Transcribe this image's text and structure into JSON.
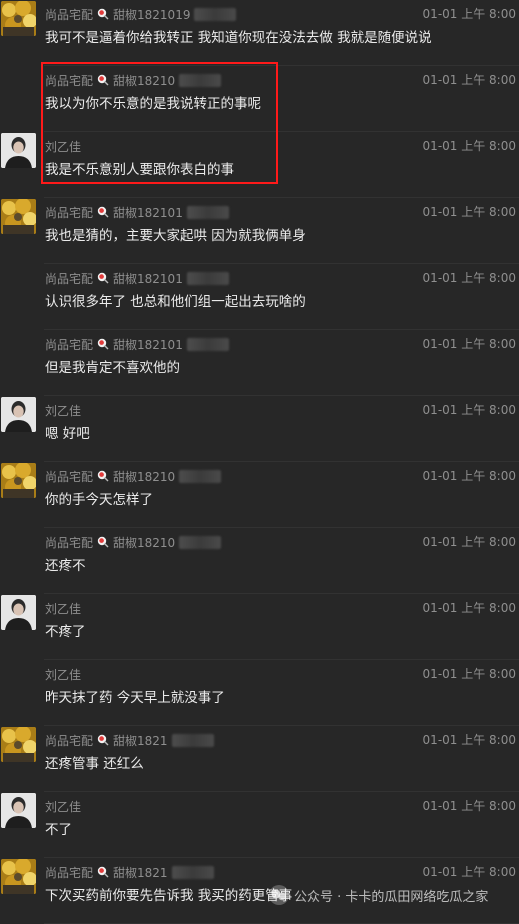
{
  "messages": [
    {
      "sender": "尚品宅配",
      "tag": "甜椒1821019",
      "time": "01-01 上午 8:00",
      "text": "我可不是逼着你给我转正 我知道你现在没法去做 我就是随便说说",
      "avatar": "yellow"
    },
    {
      "sender": "尚品宅配",
      "tag": "甜椒18210",
      "time": "01-01 上午 8:00",
      "text": "我以为你不乐意的是我说转正的事呢",
      "avatar": ""
    },
    {
      "sender": "刘乙佳",
      "tag": "",
      "time": "01-01 上午 8:00",
      "text": "我是不乐意别人要跟你表白的事",
      "avatar": "gray"
    },
    {
      "sender": "尚品宅配",
      "tag": "甜椒182101",
      "time": "01-01 上午 8:00",
      "text": "我也是猜的，主要大家起哄 因为就我俩单身",
      "avatar": "yellow"
    },
    {
      "sender": "尚品宅配",
      "tag": "甜椒182101",
      "time": "01-01 上午 8:00",
      "text": "认识很多年了 也总和他们组一起出去玩啥的",
      "avatar": ""
    },
    {
      "sender": "尚品宅配",
      "tag": "甜椒182101",
      "time": "01-01 上午 8:00",
      "text": "但是我肯定不喜欢他的",
      "avatar": ""
    },
    {
      "sender": "刘乙佳",
      "tag": "",
      "time": "01-01 上午 8:00",
      "text": "嗯 好吧",
      "avatar": "gray"
    },
    {
      "sender": "尚品宅配",
      "tag": "甜椒18210",
      "time": "01-01 上午 8:00",
      "text": "你的手今天怎样了",
      "avatar": "yellow"
    },
    {
      "sender": "尚品宅配",
      "tag": "甜椒18210",
      "time": "01-01 上午 8:00",
      "text": "还疼不",
      "avatar": ""
    },
    {
      "sender": "刘乙佳",
      "tag": "",
      "time": "01-01 上午 8:00",
      "text": "不疼了",
      "avatar": "gray"
    },
    {
      "sender": "刘乙佳",
      "tag": "",
      "time": "01-01 上午 8:00",
      "text": "昨天抹了药 今天早上就没事了",
      "avatar": ""
    },
    {
      "sender": "尚品宅配",
      "tag": "甜椒1821",
      "time": "01-01 上午 8:00",
      "text": "还疼管事 还红么",
      "avatar": "yellow"
    },
    {
      "sender": "刘乙佳",
      "tag": "",
      "time": "01-01 上午 8:00",
      "text": "不了",
      "avatar": "gray"
    },
    {
      "sender": "尚品宅配",
      "tag": "甜椒1821",
      "time": "01-01 上午 8:00",
      "text": "下次买药前你要先告诉我 我买的药更管事",
      "avatar": "yellow"
    }
  ],
  "watermark": {
    "text": "公众号 · 卡卡的瓜田网络吃瓜之家"
  },
  "colors": {
    "highlight": "#ff1a1a",
    "background": "#272727"
  }
}
